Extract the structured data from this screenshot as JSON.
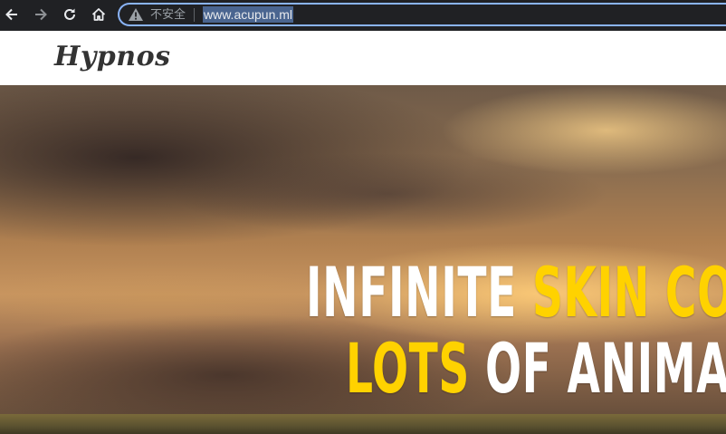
{
  "browser": {
    "security_label": "不安全",
    "url": "www.acupun.ml",
    "icons": [
      "back-arrow-icon",
      "forward-arrow-icon",
      "reload-icon",
      "home-icon",
      "warning-icon"
    ]
  },
  "site": {
    "logo": "Hypnos"
  },
  "hero": {
    "line1": {
      "white": "INFINITE",
      "yellow": "SKIN COL"
    },
    "line2": {
      "yellow": "LOTS",
      "white": "OF ANIMATIC"
    },
    "colors": {
      "white": "#ffffff",
      "highlight": "#ffd200"
    }
  }
}
